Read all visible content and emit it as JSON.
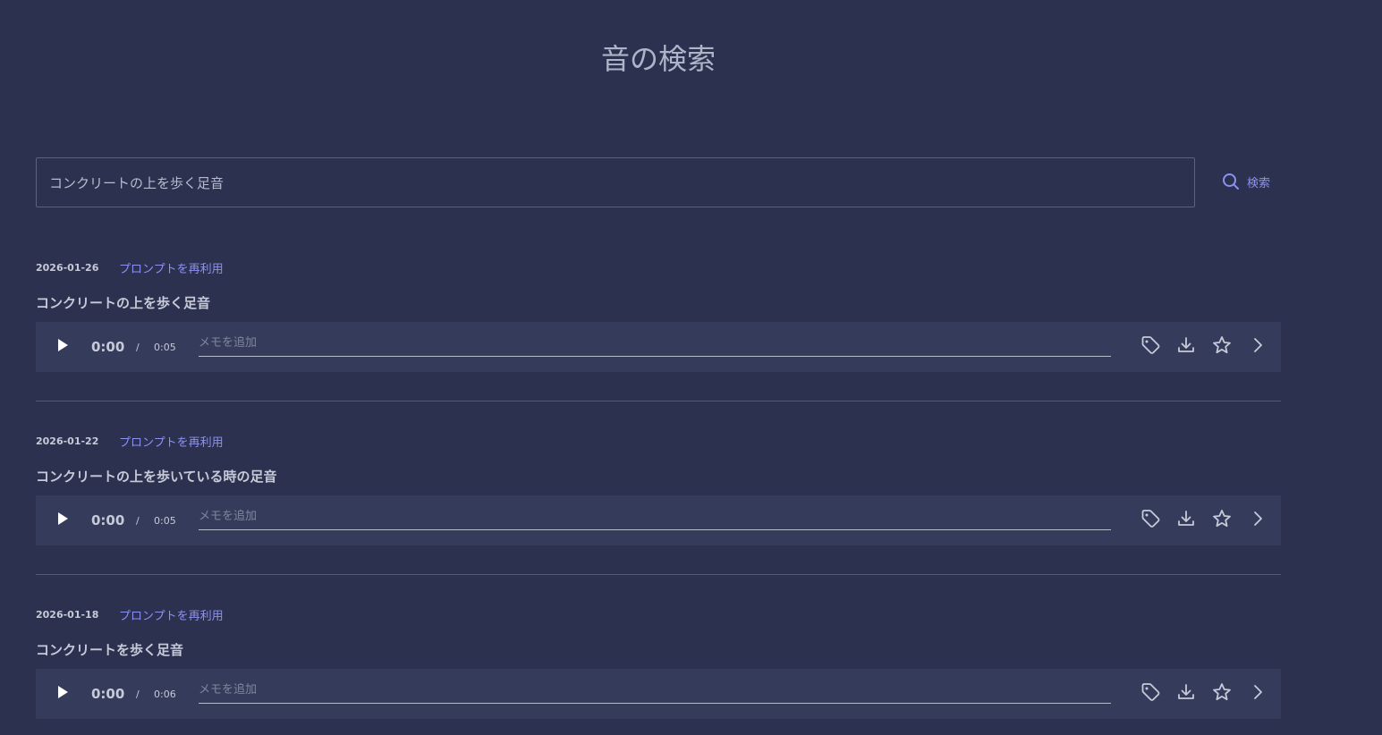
{
  "header": {
    "title": "音の検索"
  },
  "search": {
    "value": "コンクリートの上を歩く足音",
    "button_label": "検索",
    "button_icon": "search-icon"
  },
  "results": [
    {
      "date": "2026-01-26",
      "reuse_label": "プロンプトを再利用",
      "title": "コンクリートの上を歩く足音",
      "player": {
        "current": "0:00",
        "separator": "/",
        "duration": "0:05",
        "memo_placeholder": "メモを追加"
      }
    },
    {
      "date": "2026-01-22",
      "reuse_label": "プロンプトを再利用",
      "title": "コンクリートの上を歩いている時の足音",
      "player": {
        "current": "0:00",
        "separator": "/",
        "duration": "0:05",
        "memo_placeholder": "メモを追加"
      }
    },
    {
      "date": "2026-01-18",
      "reuse_label": "プロンプトを再利用",
      "title": "コンクリートを歩く足音",
      "player": {
        "current": "0:00",
        "separator": "/",
        "duration": "0:06",
        "memo_placeholder": "メモを追加"
      }
    }
  ],
  "icons": [
    "play-icon",
    "tag-icon",
    "download-icon",
    "star-icon",
    "chevron-right-icon"
  ],
  "colors": {
    "background": "#2c3150",
    "player_bg": "#353b5b",
    "accent": "#8c92f2",
    "text": "#c6cad8"
  }
}
